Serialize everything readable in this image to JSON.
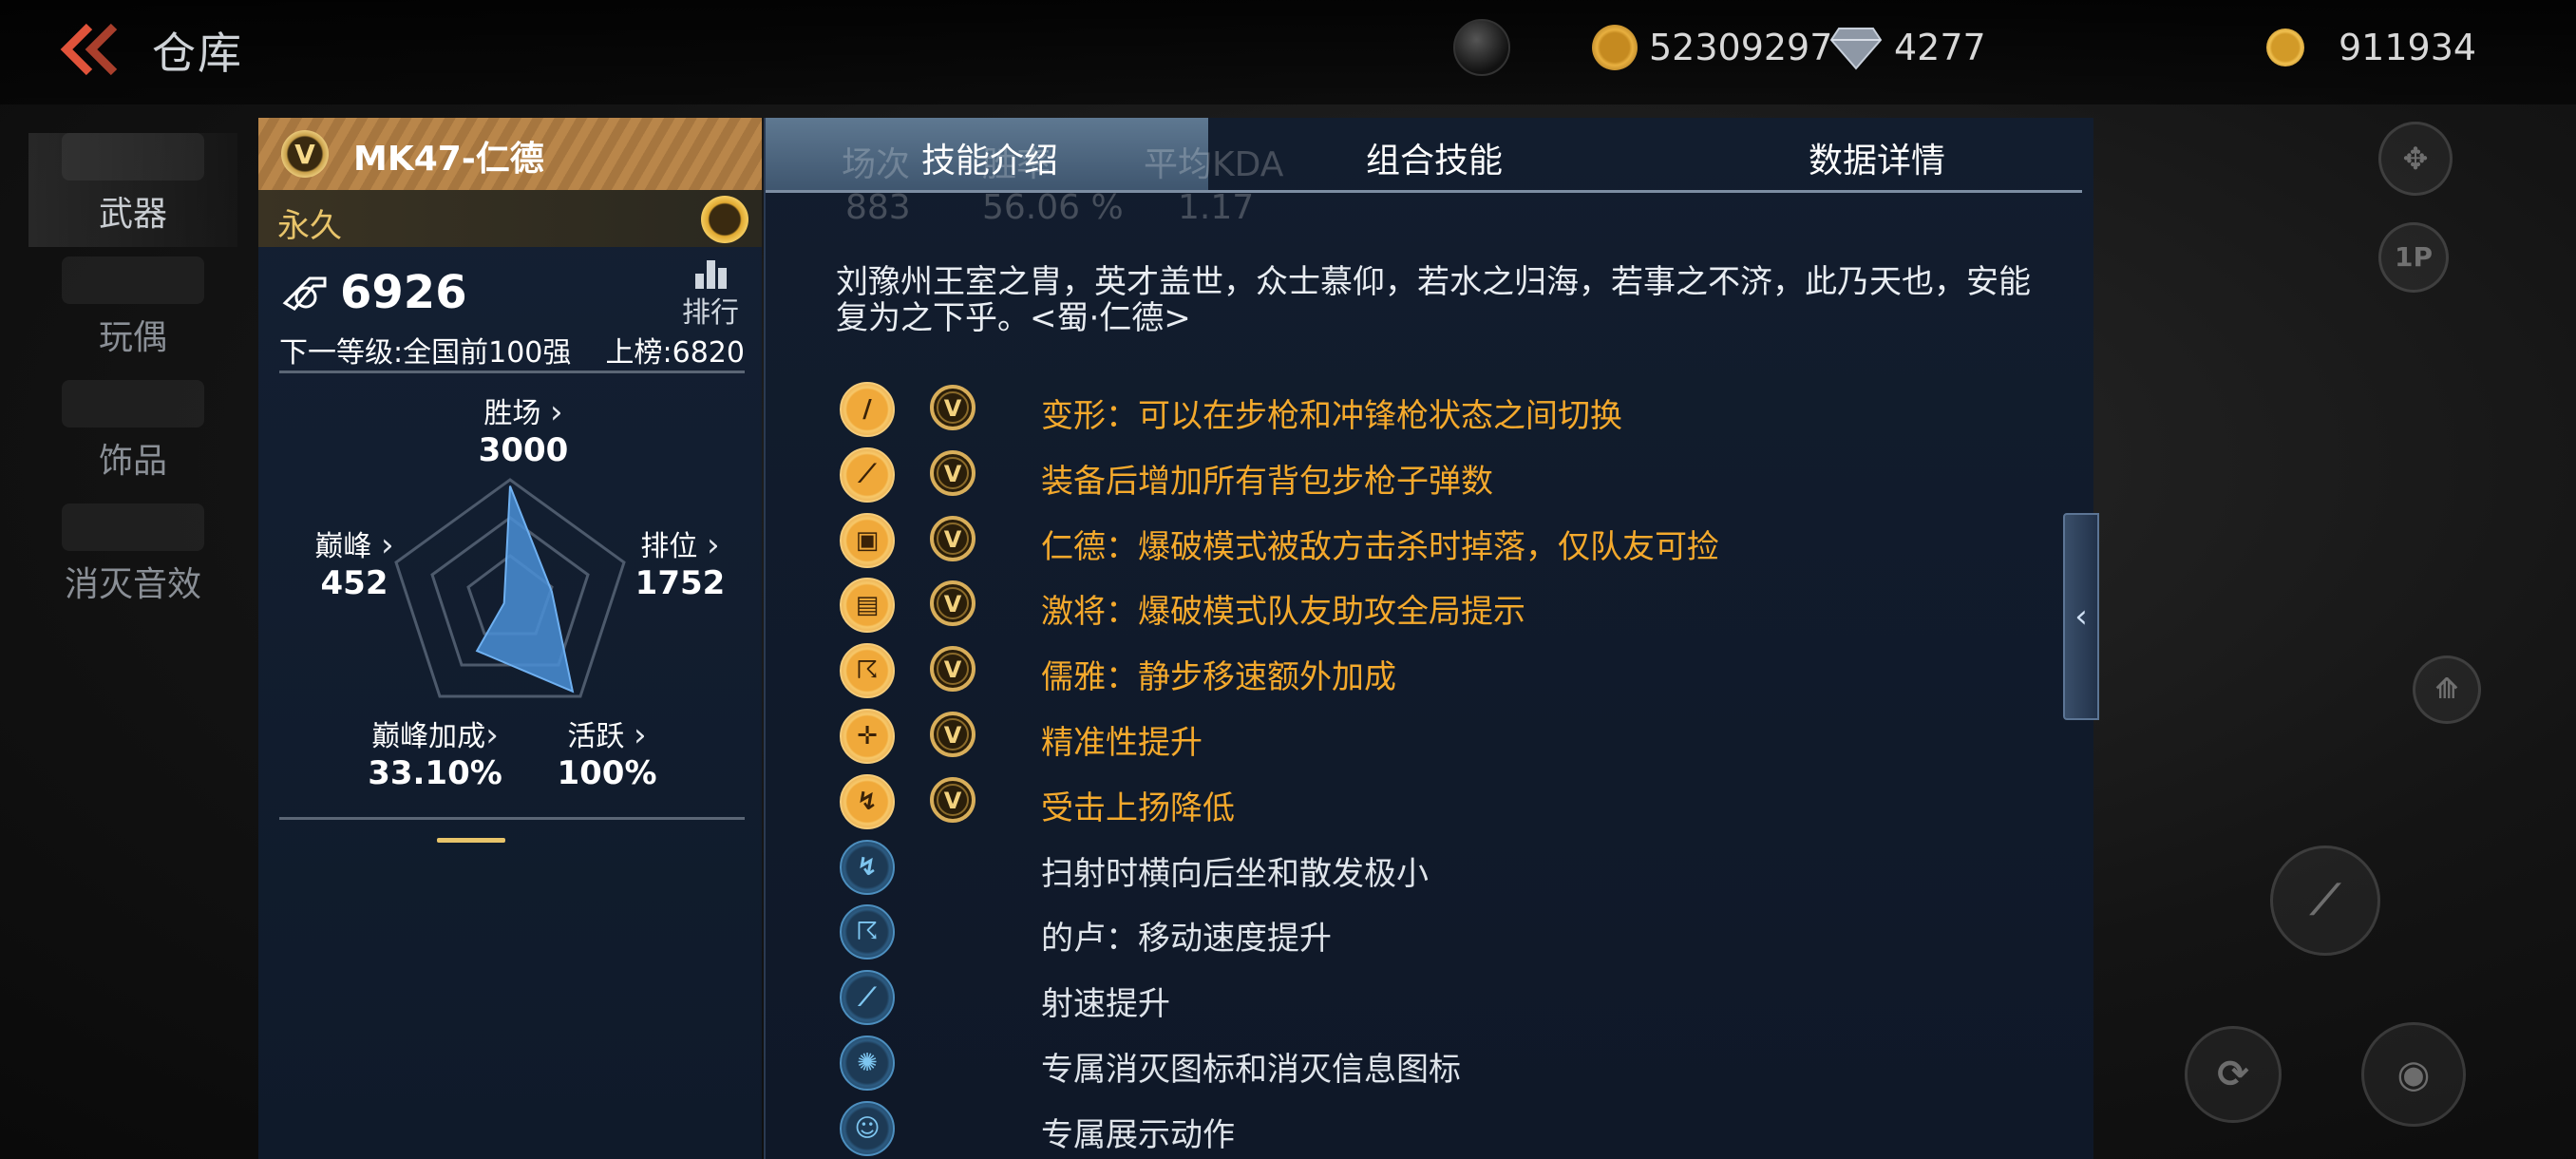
{
  "topbar": {
    "title": "仓库",
    "currency_gold": "52309297",
    "currency_diamond": "4277",
    "currency_coin": "911934"
  },
  "leftnav": {
    "items": [
      {
        "label": "武器",
        "active": true
      },
      {
        "label": "玩偶",
        "active": false
      },
      {
        "label": "饰品",
        "active": false
      },
      {
        "label": "消灭音效",
        "active": false
      }
    ]
  },
  "weapon_card": {
    "name": "MK47-仁德",
    "duration": "永久",
    "score": "6926",
    "rank_label": "排行",
    "next_level": "下一等级:全国前100强",
    "leaderboard": "上榜:6820",
    "stats": {
      "wins": {
        "label": "胜场",
        "value": "3000"
      },
      "peak": {
        "label": "巅峰",
        "value": "452"
      },
      "ranked": {
        "label": "排位",
        "value": "1752"
      },
      "peak_bonus": {
        "label": "巅峰加成",
        "value": "33.10%"
      },
      "active": {
        "label": "活跃",
        "value": "100%"
      }
    }
  },
  "tabs": {
    "skills": "技能介绍",
    "combo": "组合技能",
    "details": "数据详情",
    "ghost_headers": [
      "场次",
      "胜率",
      "平均KDA"
    ],
    "ghost_values": [
      "883",
      "56.06 %",
      "1.17"
    ]
  },
  "intro": "刘豫州王室之胄，英才盖世，众士慕仰，若水之归海，若事之不济，此乃天也，安能复为之下乎。<蜀·仁德>",
  "skills": [
    {
      "text": "变形：可以在步枪和冲锋枪状态之间切换",
      "icon": "transform-icon",
      "glyph": "/",
      "gold": true
    },
    {
      "text": "装备后增加所有背包步枪子弹数",
      "icon": "ammo-icon",
      "glyph": "⟋",
      "gold": true
    },
    {
      "text": "仁德：爆破模式被敌方击杀时掉落，仅队友可捡",
      "icon": "gift-icon",
      "glyph": "▣",
      "gold": true
    },
    {
      "text": "激将：爆破模式队友助攻全局提示",
      "icon": "assist-icon",
      "glyph": "▤",
      "gold": true
    },
    {
      "text": "儒雅：静步移速额外加成",
      "icon": "running-man-icon",
      "glyph": "☈",
      "gold": true
    },
    {
      "text": "精准性提升",
      "icon": "crosshair-icon",
      "glyph": "✛",
      "gold": true
    },
    {
      "text": "受击上扬降低",
      "icon": "recoil-icon",
      "glyph": "↯",
      "gold": true
    },
    {
      "text": "扫射时横向后坐和散发极小",
      "icon": "spray-icon",
      "glyph": "↯",
      "gold": false
    },
    {
      "text": "的卢：移动速度提升",
      "icon": "speed-icon",
      "glyph": "☈",
      "gold": false
    },
    {
      "text": "射速提升",
      "icon": "fire-rate-icon",
      "glyph": "⟋",
      "gold": false
    },
    {
      "text": "专属消灭图标和消灭信息图标",
      "icon": "kill-icon-icon",
      "glyph": "✺",
      "gold": false
    },
    {
      "text": "专属展示动作",
      "icon": "showcase-icon",
      "glyph": "☺",
      "gold": false
    }
  ],
  "radar_values": {
    "wins": 0.95,
    "ranked": 0.35,
    "active": 0.85,
    "peak_bonus": 0.45,
    "peak": 0.05
  },
  "colors": {
    "gold_text": "#f4a92c",
    "radar_fill": "#4a8fd6",
    "tab_active": "#4f6a85"
  }
}
